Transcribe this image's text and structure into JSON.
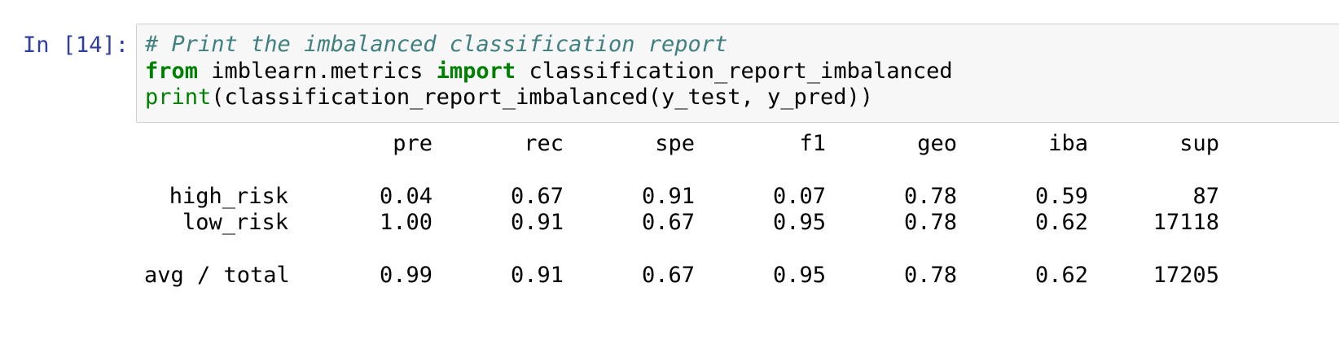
{
  "cell": {
    "prompt": "In [14]:",
    "code_lines": [
      [
        {
          "type": "comment",
          "text": "# Print the imbalanced classification report"
        }
      ],
      [
        {
          "type": "kw",
          "text": "from"
        },
        {
          "type": "text",
          "text": " imblearn.metrics "
        },
        {
          "type": "kw",
          "text": "import"
        },
        {
          "type": "text",
          "text": " classification_report_imbalanced"
        }
      ],
      [
        {
          "type": "builtin",
          "text": "print"
        },
        {
          "type": "text",
          "text": "(classification_report_imbalanced(y_test, y_pred))"
        }
      ]
    ]
  },
  "output": {
    "headers": [
      "pre",
      "rec",
      "spe",
      "f1",
      "geo",
      "iba",
      "sup"
    ],
    "rows": [
      {
        "label": "high_risk",
        "values": [
          "0.04",
          "0.67",
          "0.91",
          "0.07",
          "0.78",
          "0.59",
          "87"
        ]
      },
      {
        "label": "low_risk",
        "values": [
          "1.00",
          "0.91",
          "0.67",
          "0.95",
          "0.78",
          "0.62",
          "17118"
        ]
      }
    ],
    "total": {
      "label": "avg / total",
      "values": [
        "0.99",
        "0.91",
        "0.67",
        "0.95",
        "0.78",
        "0.62",
        "17205"
      ]
    }
  }
}
